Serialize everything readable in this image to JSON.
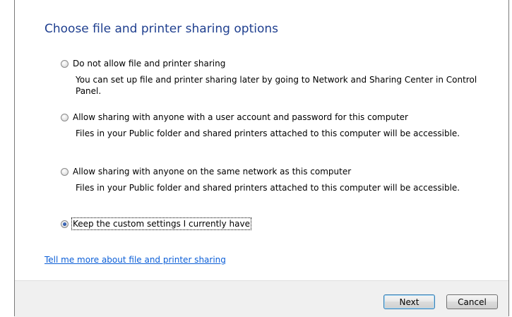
{
  "page": {
    "title": "Choose file and printer sharing options"
  },
  "options": [
    {
      "label": "Do not allow file and printer sharing",
      "description": "You can set up file and printer sharing later by going to Network and Sharing Center in Control Panel.",
      "selected": false
    },
    {
      "label": "Allow sharing with anyone with a user account and password for this computer",
      "description": "Files in your Public folder and shared printers attached to this computer will be accessible.",
      "selected": false
    },
    {
      "label": "Allow sharing with anyone on the same network as this computer",
      "description": "Files in your Public folder and shared printers attached to this computer will be accessible.",
      "selected": false
    },
    {
      "label": "Keep the custom settings I currently have",
      "selected": true
    }
  ],
  "help_link": "Tell me more about file and printer sharing",
  "footer": {
    "next_label": "Next",
    "cancel_label": "Cancel"
  },
  "colors": {
    "title": "#1f3f8f",
    "link": "#0b5ed7",
    "footer_bg": "#f0f0f0"
  }
}
